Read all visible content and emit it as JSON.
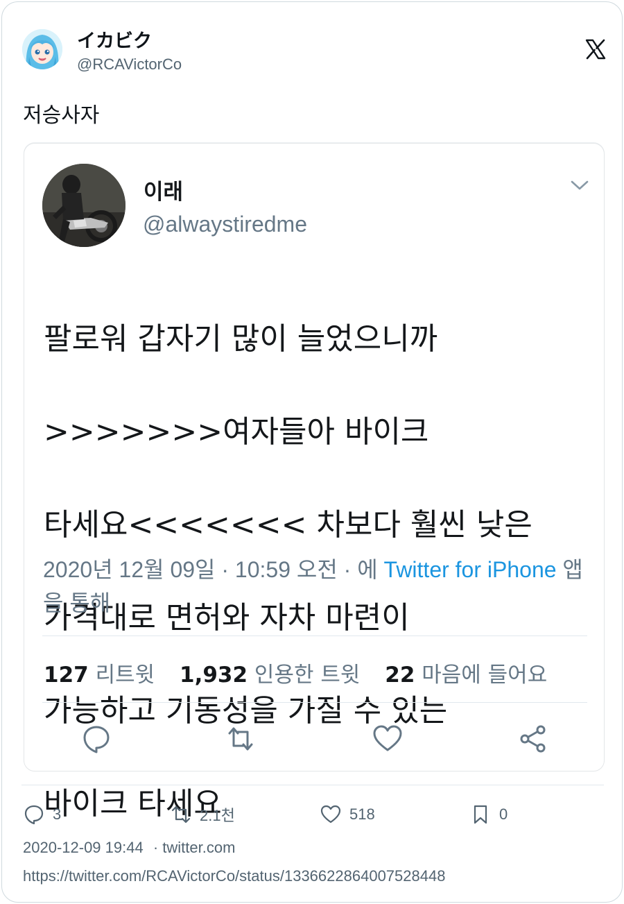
{
  "author": {
    "name": "イカビク",
    "handle": "@RCAVictorCo"
  },
  "tweet": {
    "text": "저승사자"
  },
  "quoted": {
    "name": "이래",
    "handle": "@alwaystiredme",
    "lines": [
      "팔로워 갑자기 많이 늘었으니까",
      ">>>>>>>여자들아 바이크",
      "타세요<<<<<<< 차보다 훨씬 낮은",
      "가격대로 면허와 자차 마련이",
      "가능하고 기동성을 가질 수 있는",
      "바이크 타세요"
    ],
    "meta_prefix": "2020년 12월 09일 · 10:59 오전 · 에 ",
    "meta_link": "Twitter for iPhone",
    "meta_suffix": " 앱을 통해",
    "stats": {
      "retweets_num": "127",
      "retweets_label": "리트윗",
      "quotes_num": "1,932",
      "quotes_label": "인용한 트윗",
      "likes_num": "22",
      "likes_label": "마음에 들어요"
    }
  },
  "footer": {
    "replies": "3",
    "retweets": "2.1천",
    "likes": "518",
    "bookmarks": "0",
    "time": "2020-12-09 19:44",
    "source": "· twitter.com",
    "url": "https://twitter.com/RCAVictorCo/status/1336622864007528448"
  },
  "colors": {
    "accent": "#1b95e0",
    "secondary_text": "#536471",
    "border": "#cfd9de"
  }
}
